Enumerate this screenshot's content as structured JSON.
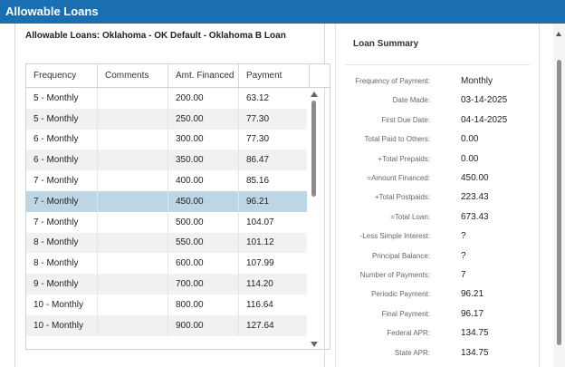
{
  "window": {
    "title": "Allowable Loans"
  },
  "loans_panel": {
    "title": "Allowable Loans: Oklahoma - OK Default - Oklahoma B Loan",
    "columns": [
      "Frequency",
      "Comments",
      "Amt. Financed",
      "Payment"
    ],
    "rows": [
      {
        "frequency": "5 - Monthly",
        "comments": "",
        "amount": "200.00",
        "payment": "63.12"
      },
      {
        "frequency": "5 - Monthly",
        "comments": "",
        "amount": "250.00",
        "payment": "77.30"
      },
      {
        "frequency": "6 - Monthly",
        "comments": "",
        "amount": "300.00",
        "payment": "77.30"
      },
      {
        "frequency": "6 - Monthly",
        "comments": "",
        "amount": "350.00",
        "payment": "86.47"
      },
      {
        "frequency": "7 - Monthly",
        "comments": "",
        "amount": "400.00",
        "payment": "85.16"
      },
      {
        "frequency": "7 - Monthly",
        "comments": "",
        "amount": "450.00",
        "payment": "96.21",
        "selected": true
      },
      {
        "frequency": "7 - Monthly",
        "comments": "",
        "amount": "500.00",
        "payment": "104.07"
      },
      {
        "frequency": "8 - Monthly",
        "comments": "",
        "amount": "550.00",
        "payment": "101.12"
      },
      {
        "frequency": "8 - Monthly",
        "comments": "",
        "amount": "600.00",
        "payment": "107.99"
      },
      {
        "frequency": "9 - Monthly",
        "comments": "",
        "amount": "700.00",
        "payment": "114.20"
      },
      {
        "frequency": "10 - Monthly",
        "comments": "",
        "amount": "800.00",
        "payment": "116.64"
      },
      {
        "frequency": "10 - Monthly",
        "comments": "",
        "amount": "900.00",
        "payment": "127.64"
      }
    ]
  },
  "loan_summary": {
    "title": "Loan Summary",
    "items": [
      {
        "label": "Frequency of Payment:",
        "value": "Monthly"
      },
      {
        "label": "Date Made:",
        "value": "03-14-2025"
      },
      {
        "label": "First Due Date:",
        "value": "04-14-2025"
      },
      {
        "label": "Total Paid to Others:",
        "value": "0.00"
      },
      {
        "label": "+Total Prepaids:",
        "value": "0.00"
      },
      {
        "label": "=Amount Financed:",
        "value": "450.00"
      },
      {
        "label": "+Total Postpaids:",
        "value": "223.43"
      },
      {
        "label": "=Total Loan:",
        "value": "673.43"
      },
      {
        "label": "-Less Simple Interest:",
        "value": "?"
      },
      {
        "label": "Principal Balance:",
        "value": "?"
      },
      {
        "label": "Number of Payments:",
        "value": "7"
      },
      {
        "label": "Periodic Payment:",
        "value": "96.21"
      },
      {
        "label": "Final Payment:",
        "value": "96.17"
      },
      {
        "label": "Federal APR:",
        "value": "134.75"
      },
      {
        "label": "State APR:",
        "value": "134.75"
      }
    ]
  },
  "colors": {
    "title_bar": "#1a6fb2",
    "selected_row": "#bcd6e6",
    "alt_row": "#f1f1f1"
  },
  "icons": {
    "grid_scroll_up": "triangle-up",
    "grid_scroll_down": "triangle-down",
    "page_scroll_up": "triangle-up"
  }
}
